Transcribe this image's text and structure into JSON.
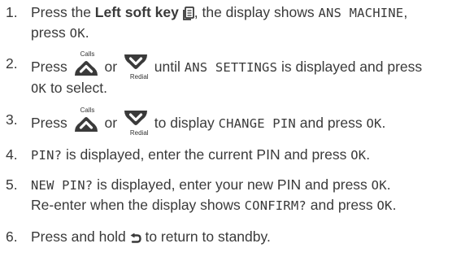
{
  "steps": [
    {
      "num": "1.",
      "t1": "Press the ",
      "bold": "Left soft key",
      "t2": ", the display shows ",
      "lcd1": "ANS MACHINE",
      "t3": ",",
      "t4": "press ",
      "lcd2": "OK",
      "t5": "."
    },
    {
      "num": "2.",
      "t1": "Press ",
      "t2": " or ",
      "t3": " until ",
      "lcd1": "ANS SETTINGS",
      "t4": " is displayed and press",
      "lcd2": "OK",
      "t5": " to select."
    },
    {
      "num": "3.",
      "t1": "Press ",
      "t2": " or ",
      "t3": " to display ",
      "lcd1": "CHANGE PIN",
      "t4": " and press ",
      "lcd2": "OK",
      "t5": "."
    },
    {
      "num": "4.",
      "lcd1": "PIN?",
      "t1": " is displayed, enter the current PIN and press ",
      "lcd2": "OK",
      "t2": "."
    },
    {
      "num": "5.",
      "lcd1": "NEW PIN?",
      "t1": " is displayed, enter your new PIN and press ",
      "lcd2": "OK",
      "t2": ".",
      "t3": "Re-enter when the display shows ",
      "lcd3": "CONFIRM?",
      "t4": " and press ",
      "lcd4": "OK",
      "t5": "."
    },
    {
      "num": "6.",
      "t1": "Press and hold ",
      "t2": " to return to standby."
    }
  ],
  "keys": {
    "up_caption": "Calls",
    "down_caption": "Redial"
  },
  "icons": {
    "soft_key": "left-soft-key-icon",
    "up": "calls-up-arrow-icon",
    "down": "redial-down-arrow-icon",
    "back": "back-end-icon"
  },
  "colors": {
    "text": "#3a3a3a",
    "key_fill": "#3a3a3a"
  }
}
